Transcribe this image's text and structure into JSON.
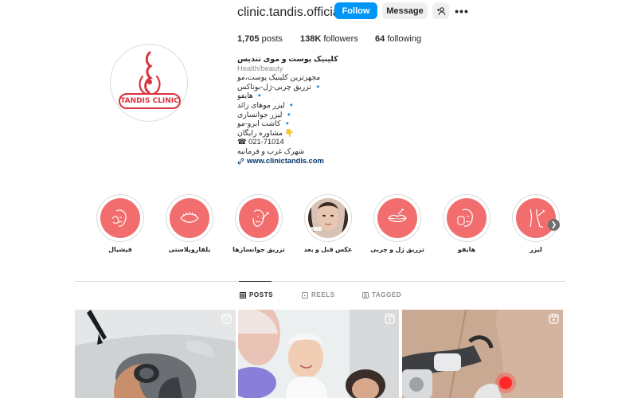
{
  "profile": {
    "username": "clinic.tandis.official",
    "follow_label": "Follow",
    "message_label": "Message",
    "more_label": "•••",
    "avatar_text": "TANDIS CLINIC",
    "stats": {
      "posts_count": "1,705",
      "posts_label": "posts",
      "followers_count": "138K",
      "followers_label": "followers",
      "following_count": "64",
      "following_label": "following"
    },
    "bio": {
      "name": "کلینیک پوست و موی تندیس",
      "category": "Health/beauty",
      "lines": [
        "مجهزترین کلینیک پوست،مو",
        "🔹 تزریق چربی-ژل-بوتاکس",
        "🔹 هایفو",
        "🔹 لیزر موهای زائد",
        "🔹 لیزر جوانسازی",
        "🔹 کاشت ابرو-مو",
        "👇 مشاوره رایگان",
        "☎ 021-71014",
        "شهرک غرب و فرمانیه"
      ],
      "link": "www.clinictandis.com"
    }
  },
  "highlights": [
    {
      "label": "فیشیال",
      "icon": "face-massage-icon"
    },
    {
      "label": "بلفاروپلاستی",
      "icon": "eyelid-icon"
    },
    {
      "label": "تزریق جوانسازها",
      "icon": "face-injection-icon"
    },
    {
      "label": "عکس قبل و بعد",
      "icon": "before-after-photo"
    },
    {
      "label": "تزریق ژل و چربی",
      "icon": "lips-icon"
    },
    {
      "label": "هایفو",
      "icon": "hifu-face-icon"
    },
    {
      "label": "لیزر",
      "icon": "laser-leg-icon"
    }
  ],
  "tabs": {
    "posts": "POSTS",
    "reels": "REELS",
    "tagged": "TAGGED"
  },
  "colors": {
    "accent_blue": "#0095f6",
    "highlight_coral": "#f26d6d",
    "brand_red": "#d9333f"
  }
}
